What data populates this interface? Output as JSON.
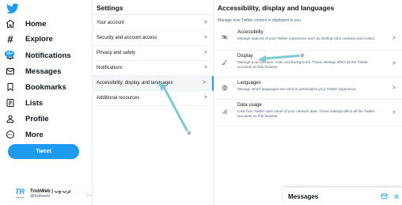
{
  "sidebar": {
    "items": [
      {
        "label": "Home",
        "icon": "home-icon"
      },
      {
        "label": "Explore",
        "icon": "hashtag-icon"
      },
      {
        "label": "Notifications",
        "icon": "bell-icon",
        "badge": "20+"
      },
      {
        "label": "Messages",
        "icon": "envelope-icon"
      },
      {
        "label": "Bookmarks",
        "icon": "bookmark-icon"
      },
      {
        "label": "Lists",
        "icon": "list-icon"
      },
      {
        "label": "Profile",
        "icon": "person-icon"
      },
      {
        "label": "More",
        "icon": "more-circle-icon"
      }
    ],
    "tweet_label": "Tweet",
    "account": {
      "name": "TrobWeb | ترب وب",
      "handle": "@trobweb",
      "avatar_text": "TR",
      "avatar_sub": "ترب وب",
      "more": "..."
    }
  },
  "settings": {
    "title": "Settings",
    "items": [
      {
        "label": "Your account"
      },
      {
        "label": "Security and account access"
      },
      {
        "label": "Privacy and safety"
      },
      {
        "label": "Notifications"
      },
      {
        "label": "Accessibility, display, and languages",
        "active": true
      },
      {
        "label": "Additional resources"
      }
    ]
  },
  "detail": {
    "title": "Accessibility, display and languages",
    "subtitle": "Manage how Twitter content is displayed to you.",
    "items": [
      {
        "title": "Accessibility",
        "desc": "Manage aspects of your Twitter experience such as limiting color contrast and motion.",
        "icon": "eye-icon"
      },
      {
        "title": "Display",
        "desc": "Manage your font size, color and background. These settings affect all the Twitter accounts on this browser.",
        "icon": "brush-icon"
      },
      {
        "title": "Languages",
        "desc": "Manage which languages are used to personalize your Twitter experience.",
        "icon": "globe-icon"
      },
      {
        "title": "Data usage",
        "desc": "Limit how Twitter uses some of your network data. These settings affect all the Twitter accounts on this browser.",
        "icon": "bar-chart-icon"
      }
    ]
  },
  "messages": {
    "title": "Messages"
  },
  "colors": {
    "accent": "#1d9bf0",
    "text": "#0f1419",
    "secondary": "#536471",
    "arrow": "#7ecbd6"
  }
}
